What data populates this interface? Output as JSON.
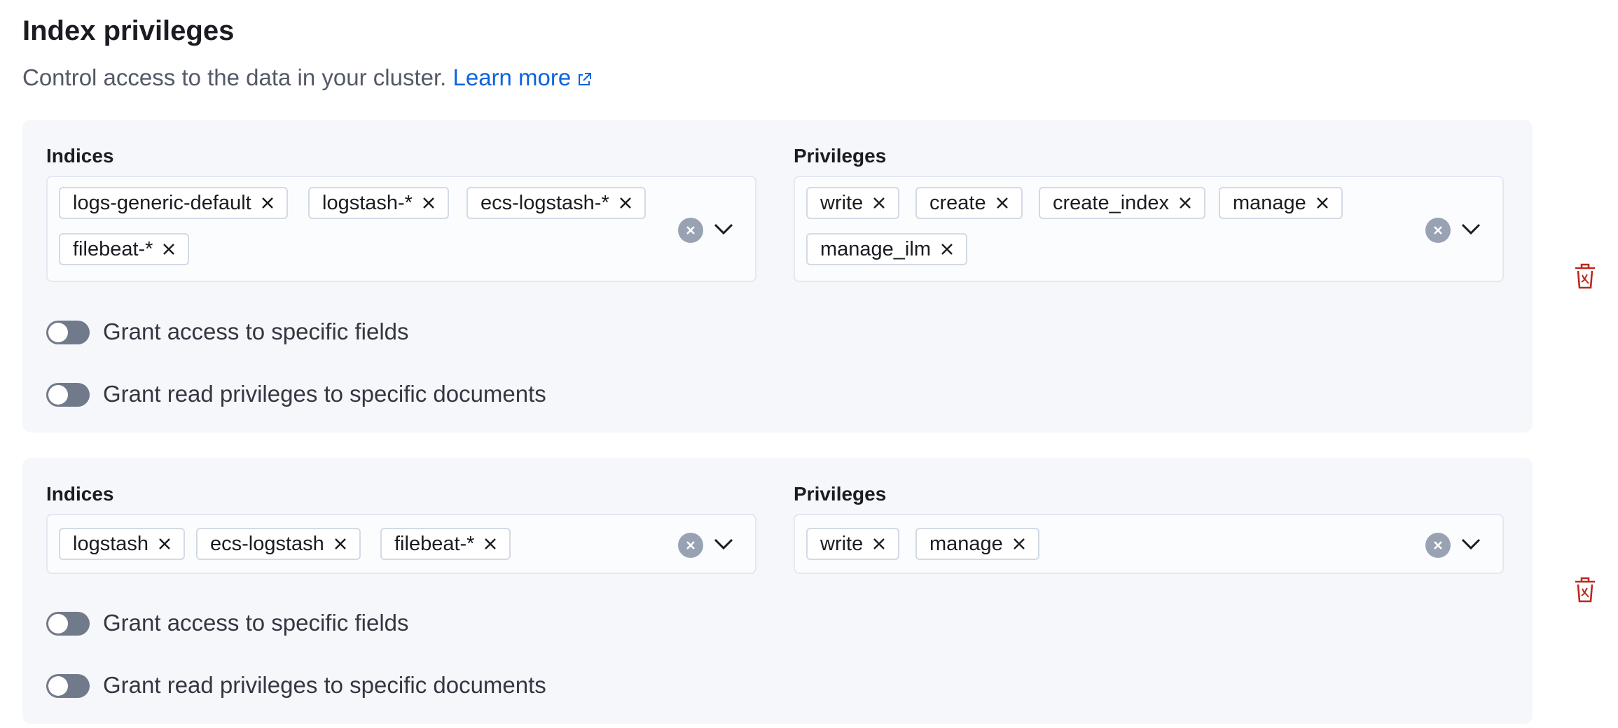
{
  "header": {
    "title": "Index privileges",
    "description": "Control access to the data in your cluster.",
    "learn_more": "Learn more"
  },
  "colors": {
    "link": "#0b64dd",
    "danger": "#bd271e",
    "panel_bg": "#f5f7fb",
    "toggle_off": "#707a8a"
  },
  "groups": [
    {
      "indices_label": "Indices",
      "privileges_label": "Privileges",
      "indices": [
        "logs-generic-default",
        "logstash-*",
        "ecs-logstash-*",
        "filebeat-*"
      ],
      "privileges": [
        "write",
        "create",
        "create_index",
        "manage",
        "manage_ilm"
      ],
      "field_toggle_label": "Grant access to specific fields",
      "field_toggle_on": false,
      "doc_toggle_label": "Grant read privileges to specific documents",
      "doc_toggle_on": false
    },
    {
      "indices_label": "Indices",
      "privileges_label": "Privileges",
      "indices": [
        "logstash",
        "ecs-logstash",
        "filebeat-*"
      ],
      "privileges": [
        "write",
        "manage"
      ],
      "field_toggle_label": "Grant access to specific fields",
      "field_toggle_on": false,
      "doc_toggle_label": "Grant read privileges to specific documents",
      "doc_toggle_on": false
    }
  ],
  "icons": {
    "pill_remove": "cross-icon",
    "clear": "clear-circle-icon",
    "open": "chevron-down-icon",
    "delete": "trash-icon",
    "external": "external-link-icon"
  }
}
